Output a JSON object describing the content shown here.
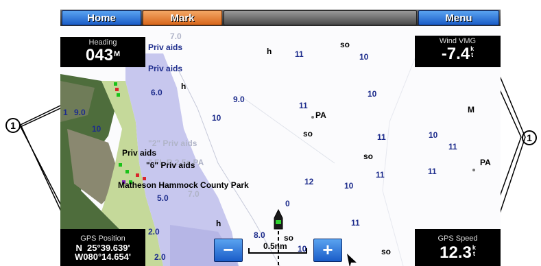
{
  "toolbar": {
    "home_label": "Home",
    "mark_label": "Mark",
    "menu_label": "Menu"
  },
  "heading": {
    "label": "Heading",
    "value": "043",
    "unit": "M"
  },
  "wind_vmg": {
    "label": "Wind VMG",
    "value": "-7.4",
    "unit_top": "k",
    "unit_bottom": "t"
  },
  "gps_position": {
    "label": "GPS Position",
    "lat": "N  25°39.639'",
    "lon": "W080°14.654'"
  },
  "gps_speed": {
    "label": "GPS Speed",
    "value": "12.3",
    "unit_top": "k",
    "unit_bottom": "t"
  },
  "scale": {
    "text": "0.5nm"
  },
  "callouts": {
    "left": "1",
    "right": "1"
  },
  "map": {
    "labels": {
      "priv_aids_1": "Priv aids",
      "priv_aids_2": "Priv aids",
      "priv_aids_3": "\"2\" Priv aids",
      "priv_aids_4": "Priv aids",
      "priv_aids_5": "\"6\" Priv aids",
      "fl_label": "\" FL R 2.5s,PA",
      "park_label": "Matheson Hammock County Park",
      "pa_1": "PA",
      "pa_2": "PA",
      "m_label": "M"
    },
    "depths": {
      "d1": "7.0",
      "d2": "h",
      "d3": "11",
      "d4": "10",
      "d5": "so",
      "d6": "6.0",
      "d7": "h",
      "d8": "9.0",
      "d9": "10",
      "d10": "11",
      "d11": "10",
      "d12": "so",
      "d13": "11",
      "d14": "10",
      "d15": "11",
      "d16": "so",
      "d17": "11",
      "d18": "11",
      "d19": "12",
      "d20": "10",
      "d21": "5.0",
      "d22": "7.0",
      "d23": "0",
      "d24": "11",
      "d25": "h",
      "d26": "8.0",
      "d27": "so",
      "d28": "10",
      "d29": "so",
      "d30": "2.0",
      "d31": "2.0",
      "d32": "9.0",
      "d33": "10",
      "d34": "1"
    }
  }
}
